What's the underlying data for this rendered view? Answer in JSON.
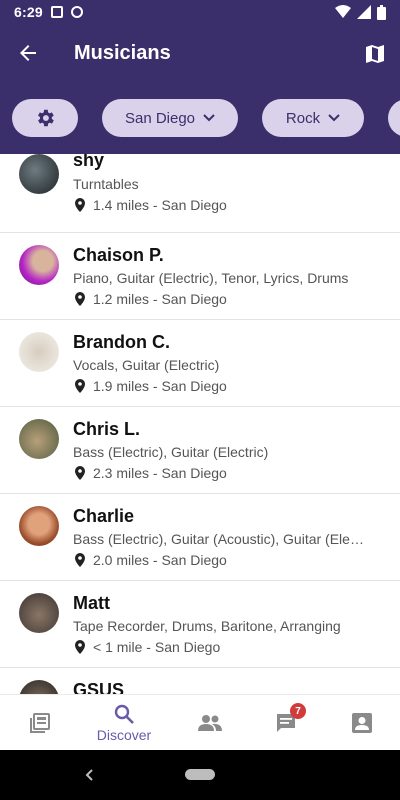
{
  "status_bar": {
    "time": "6:29"
  },
  "app_bar": {
    "title": "Musicians"
  },
  "filters": {
    "location": "San Diego",
    "genre": "Rock"
  },
  "musicians": [
    {
      "name": "shy",
      "instruments": "Turntables",
      "location": "1.4 miles - San Diego"
    },
    {
      "name": "Chaison P.",
      "instruments": "Piano, Guitar (Electric), Tenor, Lyrics, Drums",
      "location": "1.2 miles - San Diego"
    },
    {
      "name": "Brandon C.",
      "instruments": "Vocals, Guitar (Electric)",
      "location": "1.9 miles - San Diego"
    },
    {
      "name": "Chris L.",
      "instruments": "Bass (Electric), Guitar (Electric)",
      "location": "2.3 miles - San Diego"
    },
    {
      "name": "Charlie",
      "instruments": "Bass (Electric), Guitar (Acoustic), Guitar (Ele…",
      "location": "2.0 miles - San Diego"
    },
    {
      "name": "Matt",
      "instruments": "Tape Recorder, Drums, Baritone, Arranging",
      "location": "< 1 mile - San Diego"
    },
    {
      "name": "GSUS"
    }
  ],
  "bottom_nav": {
    "discover_label": "Discover",
    "messages_badge": "7"
  },
  "colors": {
    "primary": "#3b2f6b",
    "chip": "#d9d2ea",
    "accent": "#6a5aa8",
    "badge": "#d23b3b"
  }
}
